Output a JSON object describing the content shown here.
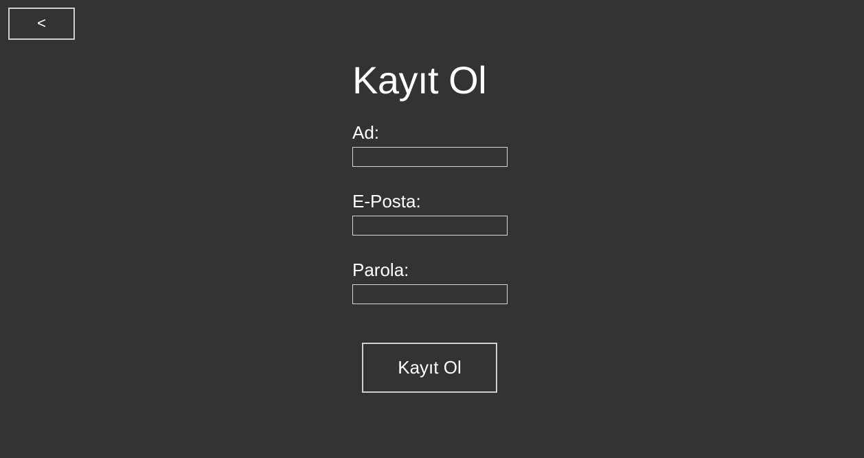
{
  "nav": {
    "back_label": "<"
  },
  "form": {
    "title": "Kayıt Ol",
    "fields": [
      {
        "label": "Ad:",
        "value": "",
        "placeholder": ""
      },
      {
        "label": "E-Posta:",
        "value": "",
        "placeholder": ""
      },
      {
        "label": "Parola:",
        "value": "",
        "placeholder": ""
      }
    ],
    "submit_label": "Kayıt Ol"
  },
  "colors": {
    "background": "#333333",
    "text": "#ffffff",
    "border": "#cfcfcf"
  }
}
